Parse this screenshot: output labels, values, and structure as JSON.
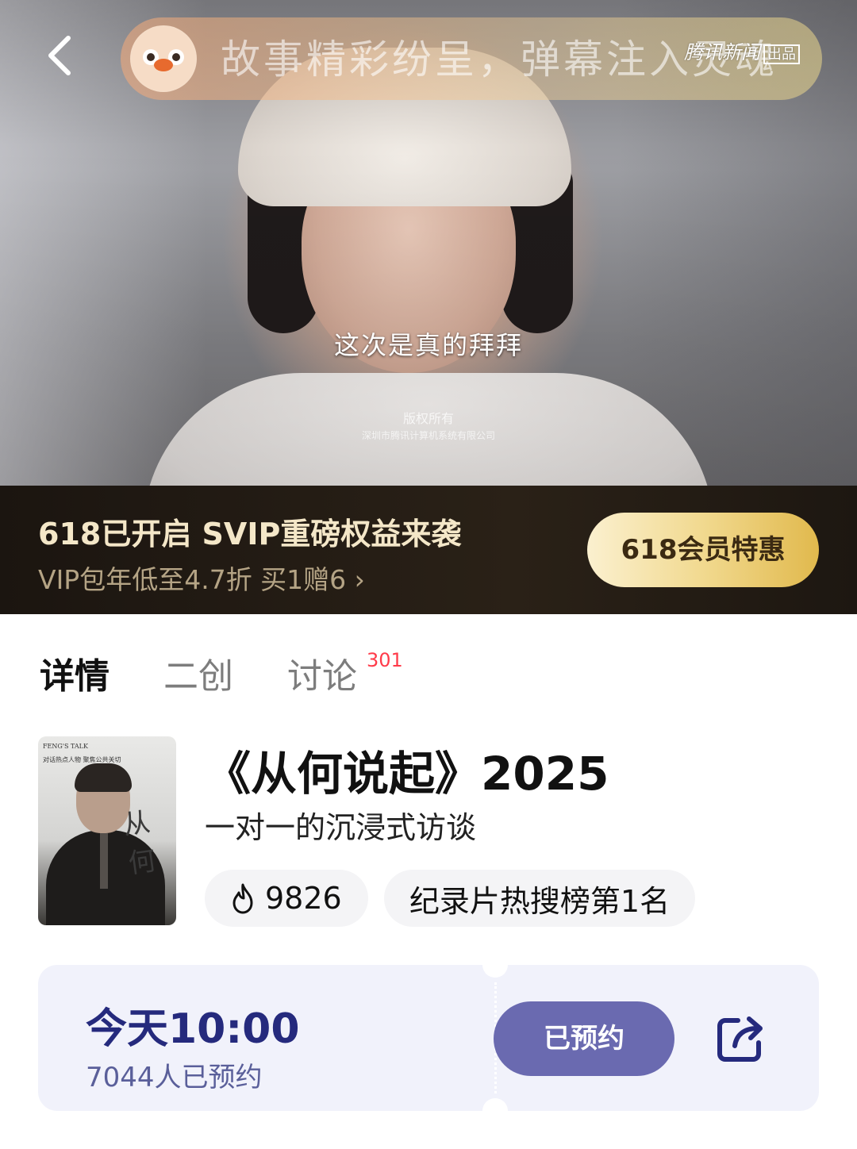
{
  "video": {
    "danmaku_placeholder": "故事精彩纷呈，弹幕注入灵魂",
    "brand": "腾讯新闻",
    "brand_badge": "出品",
    "subtitle": "这次是真的拜拜",
    "watermark_line1": "版权所有",
    "watermark_line2": "深圳市腾讯计算机系统有限公司"
  },
  "promo": {
    "title": "618已开启 SVIP重磅权益来袭",
    "subtitle": "VIP包年低至4.7折 买1赠6 ›",
    "button_label": "618会员特惠"
  },
  "tabs": [
    {
      "label": "详情",
      "active": true
    },
    {
      "label": "二创",
      "active": false
    },
    {
      "label": "讨论",
      "active": false,
      "badge": "301"
    }
  ],
  "show": {
    "title": "《从何说起》2025",
    "description": "一对一的沉浸式访谈",
    "heat": "9826",
    "rank_label": "纪录片热搜榜第1名",
    "poster_text_line1": "FENG'S TALK",
    "poster_text_line2": "对话热点人物 聚焦公共关切",
    "poster_callig": "从何"
  },
  "reservation": {
    "time": "今天10:00",
    "count": "7044人已预约",
    "button_label": "已预约"
  },
  "colors": {
    "promo_bg": "#1b1510",
    "promo_gold": "#f1d98f",
    "reserve_text": "#252a7d",
    "reserve_button": "#6a6ab0",
    "tab_badge": "#ff3b4a"
  }
}
